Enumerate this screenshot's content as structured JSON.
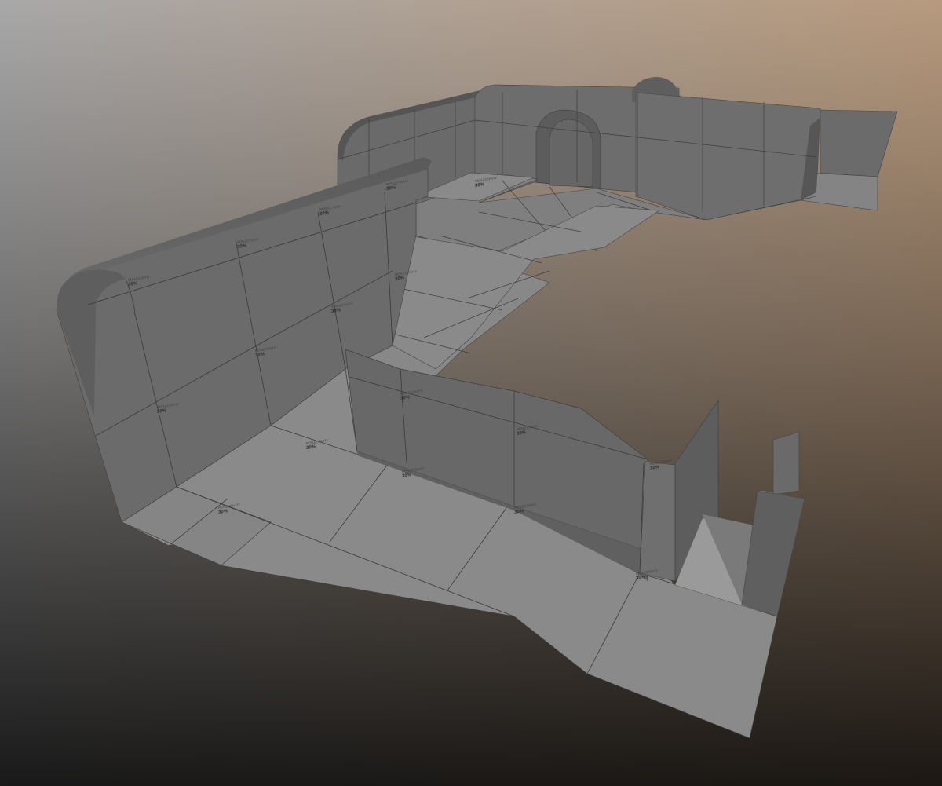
{
  "scene": {
    "description_label": "",
    "background": {
      "top_left": "#a9a8a8",
      "top_right": "#b7987a",
      "bottom_left": "#1f1c1b",
      "bottom_right": "#3e3126"
    },
    "colors": {
      "floor": "#8a8a8a",
      "wall": "#666666",
      "wall_dark": "#5c5c5c",
      "wall_top": "#555555",
      "grid_line": "#3a3a3a"
    }
  },
  "tile_labels": [
    {
      "title": "REFLECTIVITY",
      "value": "30%"
    },
    {
      "title": "REFLECTIVITY",
      "value": "30%"
    },
    {
      "title": "REFLECTIVITY",
      "value": "30%"
    },
    {
      "title": "REFLECTIVITY",
      "value": "30%"
    },
    {
      "title": "REFLECTIVITY",
      "value": "30%"
    },
    {
      "title": "REFLECTIVITY",
      "value": "30%"
    },
    {
      "title": "REFLECTIVITY",
      "value": "30%"
    },
    {
      "title": "REFLECTIVITY",
      "value": "30%"
    },
    {
      "title": "REFLECTIVITY",
      "value": "30%"
    },
    {
      "title": "REFLECTIVITY",
      "value": "30%"
    },
    {
      "title": "REFLECTIVITY",
      "value": "30%"
    },
    {
      "title": "REFLECTIVITY",
      "value": "30%"
    },
    {
      "title": "REFLECTIVITY",
      "value": "30%"
    },
    {
      "title": "REFLECTIVITY",
      "value": "30%"
    },
    {
      "title": "REFLECTIVITY",
      "value": "30%"
    },
    {
      "title": "REFLECTIVITY",
      "value": "30%"
    },
    {
      "title": "REFLECTIVITY",
      "value": "30%"
    }
  ]
}
